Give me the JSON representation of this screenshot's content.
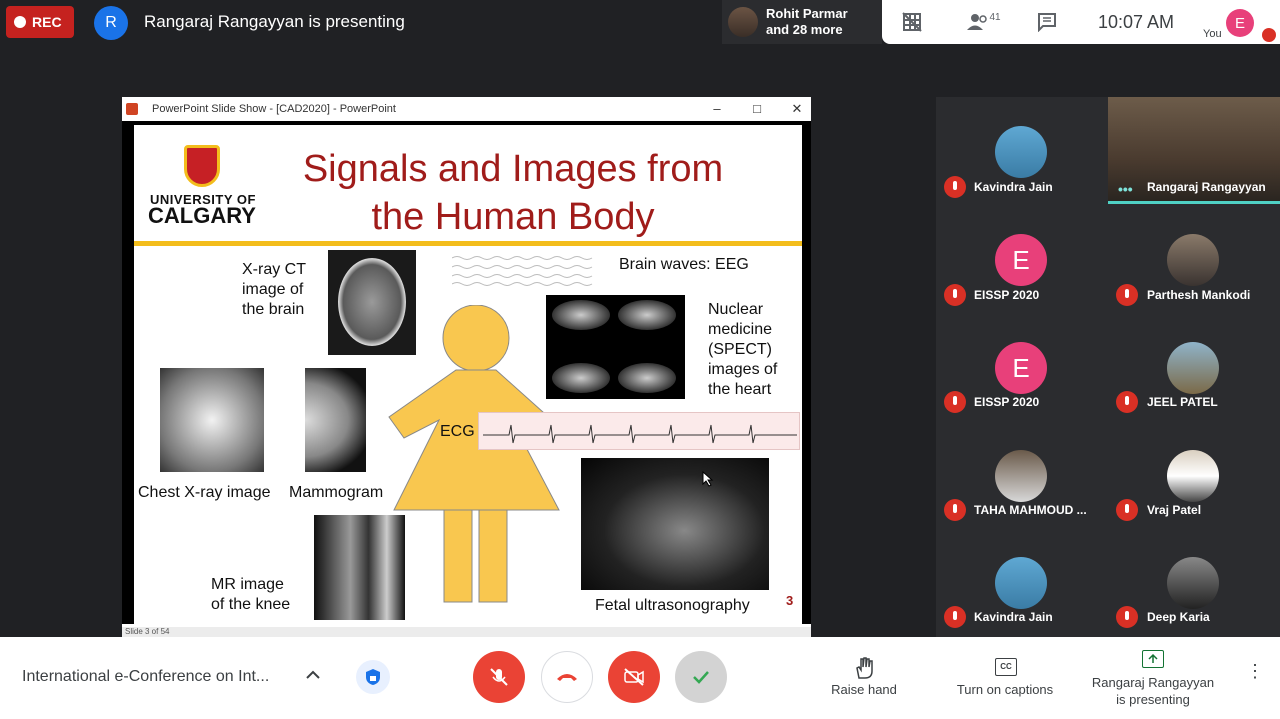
{
  "topbar": {
    "rec_label": "REC",
    "presenter_initial": "R",
    "presenting_text": "Rangaraj Rangayyan is presenting",
    "others_text_1": "Rohit Parmar",
    "others_text_2": "and 28 more",
    "people_count": "41",
    "time": "10:07  AM",
    "you_initial": "E",
    "you_label": "You"
  },
  "ppt": {
    "window_title": "PowerPoint Slide Show - [CAD2020] - PowerPoint",
    "status": "Slide 3 of 54"
  },
  "slide": {
    "title_line1": "Signals and Images from",
    "title_line2": "the Human Body",
    "uni_line1": "UNIVERSITY OF",
    "uni_line2": "CALGARY",
    "label_ct_1": "X-ray CT",
    "label_ct_2": "image of",
    "label_ct_3": "the brain",
    "label_eeg": "Brain waves: EEG",
    "label_nuc_1": "Nuclear",
    "label_nuc_2": "medicine",
    "label_nuc_3": "(SPECT)",
    "label_nuc_4": "images of",
    "label_nuc_5": "the heart",
    "label_chest": "Chest X-ray image",
    "label_mammo": "Mammogram",
    "label_ecg": "ECG",
    "label_mr_1": "MR image",
    "label_mr_2": "of the knee",
    "label_fetal": "Fetal ultrasonography",
    "page_number": "3"
  },
  "participants": [
    {
      "name": "Kavindra Jain"
    },
    {
      "name": "Rangaraj Rangayyan"
    },
    {
      "name": "EISSP 2020",
      "initial": "E"
    },
    {
      "name": "Parthesh Mankodi"
    },
    {
      "name": "EISSP 2020",
      "initial": "E"
    },
    {
      "name": "JEEL PATEL"
    },
    {
      "name": "TAHA MAHMOUD ..."
    },
    {
      "name": "Vraj Patel"
    },
    {
      "name": "Kavindra Jain"
    },
    {
      "name": "Deep Karia"
    }
  ],
  "bottombar": {
    "meeting_title": "International e-Conference on Int...",
    "raise_hand": "Raise hand",
    "captions": "Turn on captions",
    "presenting_1": "Rangaraj Rangayyan",
    "presenting_2": "is presenting"
  }
}
